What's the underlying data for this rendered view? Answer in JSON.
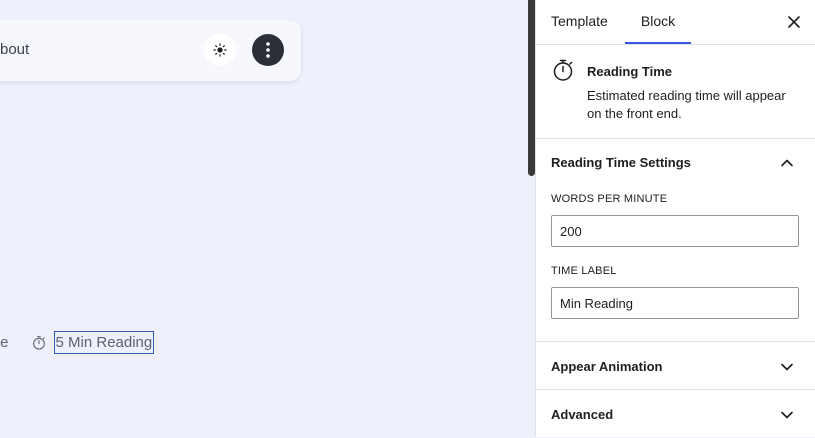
{
  "canvas": {
    "nav_item": "bout",
    "meta_prev": "te",
    "reading_time": "5 Min Reading"
  },
  "sidebar": {
    "tabs": [
      {
        "label": "Template",
        "active": false
      },
      {
        "label": "Block",
        "active": true
      }
    ],
    "block": {
      "icon": "stopwatch-icon",
      "title": "Reading Time",
      "description": "Estimated reading time will appear on the front end."
    },
    "settings_panel": {
      "title": "Reading Time Settings",
      "expanded": true,
      "words_per_minute": {
        "label": "WORDS PER MINUTE",
        "value": "200"
      },
      "time_label": {
        "label": "TIME LABEL",
        "value": "Min Reading"
      }
    },
    "panels": [
      {
        "title": "Appear Animation",
        "expanded": false
      },
      {
        "title": "Advanced",
        "expanded": false
      }
    ]
  },
  "colors": {
    "canvas_bg": "#eef1fb",
    "accent": "#3858e9",
    "selection_outline": "#2f5fa8",
    "menu_button": "#2c2f38"
  }
}
